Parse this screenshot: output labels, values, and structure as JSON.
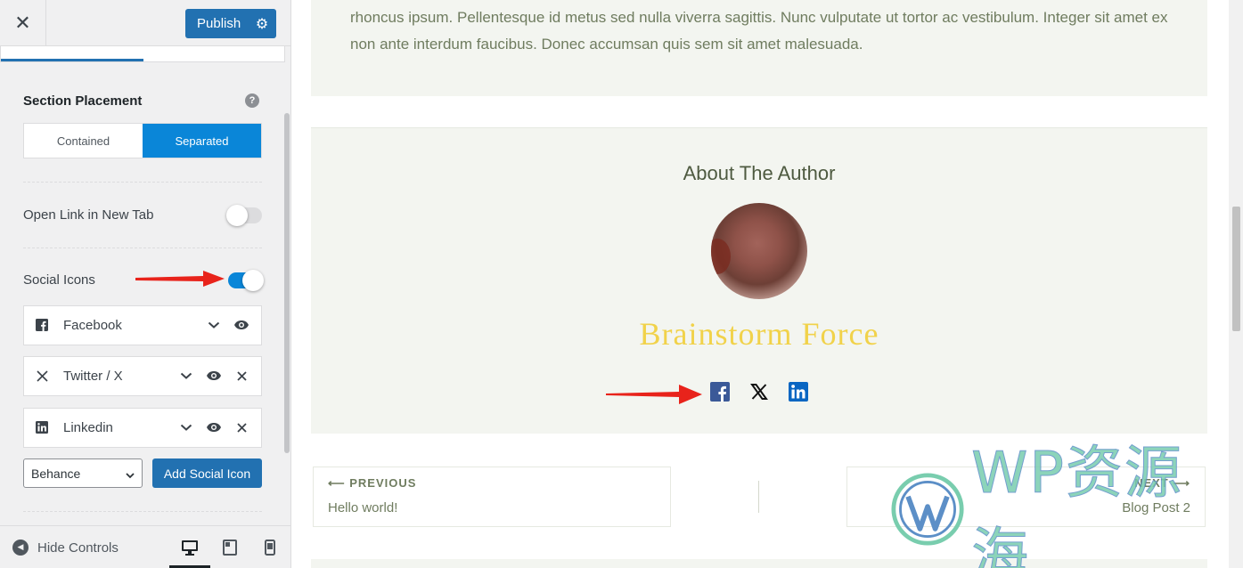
{
  "header": {
    "close_icon": "close-icon",
    "publish_label": "Publish",
    "settings_icon": "gear-icon"
  },
  "section_placement": {
    "title": "Section Placement",
    "help_icon": "help-icon",
    "options": [
      "Contained",
      "Separated"
    ],
    "selected": "Separated"
  },
  "open_link_new_tab": {
    "label": "Open Link in New Tab",
    "enabled": false
  },
  "social_icons": {
    "label": "Social Icons",
    "enabled": true,
    "items": [
      {
        "label": "Facebook",
        "icon": "facebook-icon"
      },
      {
        "label": "Twitter / X",
        "icon": "x-icon"
      },
      {
        "label": "Linkedin",
        "icon": "linkedin-icon"
      }
    ],
    "select_value": "Behance",
    "add_button_label": "Add Social Icon"
  },
  "footer": {
    "hide_controls_label": "Hide Controls",
    "devices": [
      "desktop-icon",
      "tablet-icon",
      "mobile-icon"
    ],
    "active_device": "desktop"
  },
  "preview": {
    "body_text": "rhoncus ipsum. Pellentesque id metus sed nulla viverra sagittis. Nunc vulputate ut tortor ac vestibulum. Integer sit amet ex non ante interdum faucibus. Donec accumsan quis sem sit amet malesuada.",
    "author_heading": "About The Author",
    "author_name": "Brainstorm Force",
    "author_social": [
      "facebook-icon",
      "x-icon",
      "linkedin-icon"
    ],
    "prev_kicker": "PREVIOUS",
    "prev_title": "Hello world!",
    "next_kicker": "NEXT",
    "next_title": "Blog Post 2"
  },
  "watermark": "WP资源海",
  "colors": {
    "primary": "#2271b1",
    "toggle_on": "#0a86d8",
    "author_name": "#f1d24a",
    "content_bg": "#f3f5f0",
    "facebook": "#3b5998",
    "linkedin": "#0a66c2",
    "annotation": "#e8231b"
  }
}
